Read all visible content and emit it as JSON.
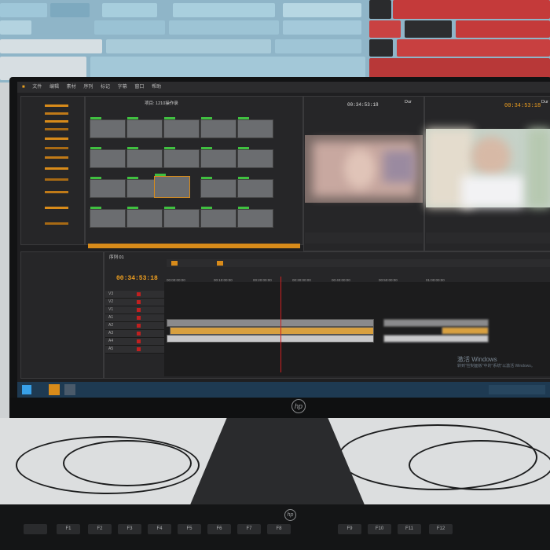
{
  "monitor": {
    "brand_logo": "hp",
    "logo_text": "hp"
  },
  "keyboard": {
    "logo_text": "hp",
    "function_keys": [
      "F1",
      "F2",
      "F3",
      "F4",
      "F5",
      "F6",
      "F7",
      "F8",
      "F9",
      "F10",
      "F11",
      "F12"
    ]
  },
  "editor": {
    "menu_items": [
      "文件",
      "编辑",
      "素材",
      "序列",
      "标记",
      "字幕",
      "窗口",
      "帮助"
    ],
    "project_path": "项目: 1210操作录",
    "source_timecode": "00:34:53:18",
    "program_timecode": "00:34:53:18",
    "timeline_timecode": "00:34:53:18",
    "dur_label": "Dur",
    "ruler_labels": [
      "00:00:00:00",
      "00:10:00:00",
      "00:20:00:00",
      "00:30:00:00",
      "00:40:00:00",
      "00:50:00:00",
      "01:00:00:00"
    ],
    "track_labels": [
      "V1",
      "V2",
      "V3",
      "A1",
      "A2",
      "A3",
      "A4",
      "A5"
    ],
    "timeline_title": "序列 01"
  },
  "os": {
    "activation_title": "激活 Windows",
    "activation_hint": "转到\"控制面板\"中的\"系统\"以激活 Windows。"
  },
  "colors": {
    "accent_orange": "#d88b1a",
    "clip_green": "#40c040",
    "playhead_red": "#d02020",
    "taskbar_blue": "#1e3a52"
  }
}
